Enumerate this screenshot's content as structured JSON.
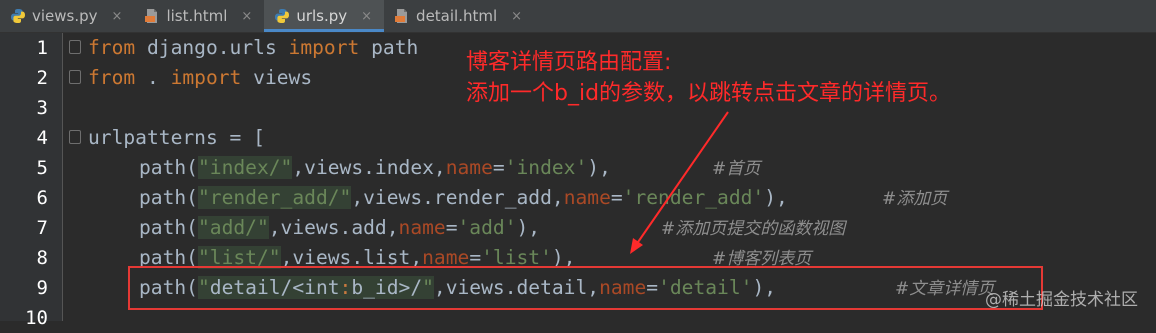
{
  "tabs": [
    {
      "label": "views.py",
      "icon": "python-file-icon",
      "active": false
    },
    {
      "label": "list.html",
      "icon": "html-file-icon",
      "active": false
    },
    {
      "label": "urls.py",
      "icon": "python-file-icon",
      "active": true
    },
    {
      "label": "detail.html",
      "icon": "html-file-icon",
      "active": false
    }
  ],
  "tab_close_glyph": "×",
  "line_numbers": [
    "1",
    "2",
    "3",
    "4",
    "5",
    "6",
    "7",
    "8",
    "9",
    "10"
  ],
  "code": {
    "l1": {
      "kw1": "from",
      "mod": " django.urls ",
      "kw2": "import",
      "name": " path"
    },
    "l2": {
      "kw1": "from",
      "mod": " . ",
      "kw2": "import",
      "name": " views"
    },
    "l4": {
      "text": "urlpatterns = ["
    },
    "l5": {
      "fn": "path(",
      "str": "\"index/\"",
      "mid": ",views.index,",
      "param": "name",
      "eq": "=",
      "val": "'index'",
      "end": "),",
      "cmt": "#首页"
    },
    "l6": {
      "fn": "path(",
      "str": "\"render_add/\"",
      "mid": ",views.render_add,",
      "param": "name",
      "eq": "=",
      "val": "'render_add'",
      "end": "),",
      "cmt": "#添加页"
    },
    "l7": {
      "fn": "path(",
      "str": "\"add/\"",
      "mid": ",views.add,",
      "param": "name",
      "eq": "=",
      "val": "'add'",
      "end": "),",
      "cmt": "#添加页提交的函数视图"
    },
    "l8": {
      "fn": "path(",
      "str": "\"list/\"",
      "mid": ",views.list,",
      "param": "name",
      "eq": "=",
      "val": "'list'",
      "end": "),",
      "cmt": "#博客列表页"
    },
    "l9": {
      "fn": "path(",
      "q1": "\"",
      "s1": "detail/<int",
      "colon": ":",
      "s2": "b_id>/",
      "q2": "\"",
      "mid": ",views.detail,",
      "param": "name",
      "eq": "=",
      "val": "'detail'",
      "end": "),",
      "cmt": "#文章详情页"
    }
  },
  "annotation": {
    "line1": "博客详情页路由配置:",
    "line2": "添加一个b_id的参数，以跳转点击文章的详情页。",
    "color": "#ff2a2a"
  },
  "watermark": "@稀土掘金技术社区"
}
